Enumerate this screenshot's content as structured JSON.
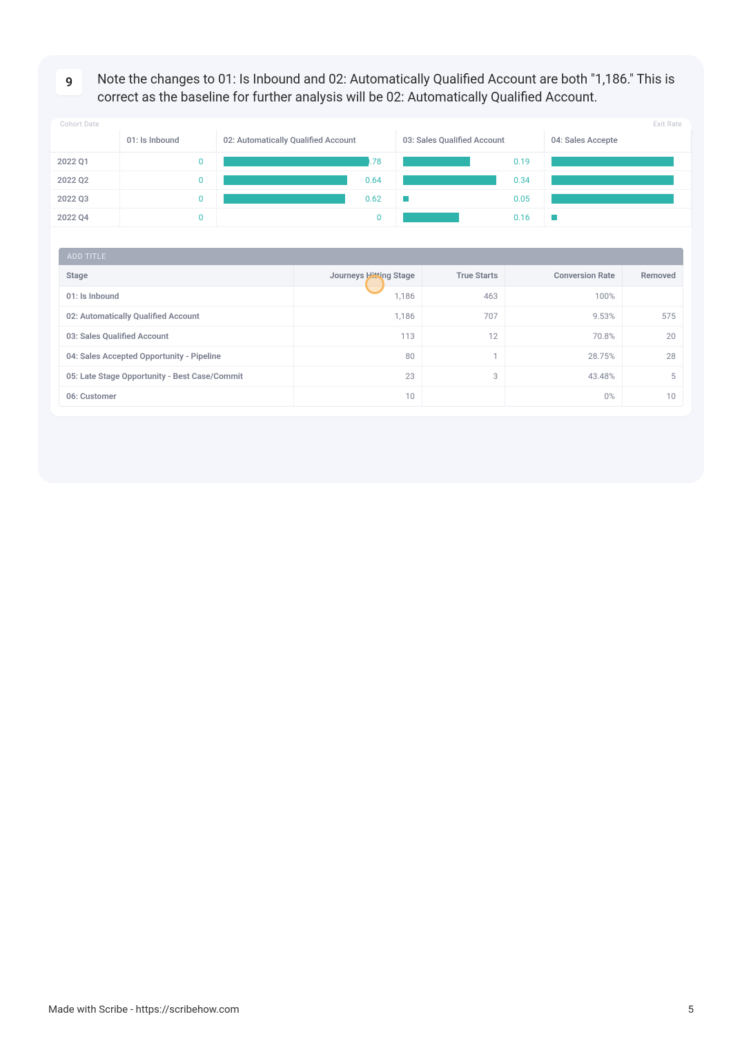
{
  "step": {
    "number": "9",
    "text": "Note the changes to 01: Is Inbound and 02: Automatically Qualified Account are both \"1,186.\" This is correct as the baseline for further analysis will be 02: Automatically Qualified Account."
  },
  "cohort": {
    "top_left": "Cohort Date",
    "top_right": "Exit Rate",
    "headers": {
      "c1": "01: Is Inbound",
      "c2": "02: Automatically Qualified Account",
      "c3": "03: Sales Qualified Account",
      "c4": "04: Sales Accepte"
    },
    "rows": [
      {
        "period": "2022 Q1",
        "inb": "0",
        "v02": "0.78",
        "w02": 88,
        "v03": "0.19",
        "w03": 50,
        "tiny03": false,
        "v04": "",
        "w04": 92,
        "tiny04": false
      },
      {
        "period": "2022 Q2",
        "inb": "0",
        "v02": "0.64",
        "w02": 75,
        "v03": "0.34",
        "w03": 70,
        "tiny03": false,
        "v04": "",
        "w04": 92,
        "tiny04": false
      },
      {
        "period": "2022 Q3",
        "inb": "0",
        "v02": "0.62",
        "w02": 74,
        "v03": "0.05",
        "w03": 0,
        "tiny03": true,
        "v04": "",
        "w04": 92,
        "tiny04": false
      },
      {
        "period": "2022 Q4",
        "inb": "0",
        "v02": "0",
        "w02": 0,
        "v03": "0.16",
        "w03": 42,
        "tiny03": false,
        "v04": "",
        "w04": 0,
        "tiny04": true
      }
    ]
  },
  "title_placeholder": "ADD TITLE",
  "stage": {
    "headers": {
      "s": "Stage",
      "j": "Journeys Hitting Stage",
      "t": "True Starts",
      "c": "Conversion Rate",
      "r": "Removed"
    },
    "rows": [
      {
        "s": "01: Is Inbound",
        "j": "1,186",
        "t": "463",
        "c": "100%",
        "r": ""
      },
      {
        "s": "02: Automatically Qualified Account",
        "j": "1,186",
        "t": "707",
        "c": "9.53%",
        "r": "575"
      },
      {
        "s": "03: Sales Qualified Account",
        "j": "113",
        "t": "12",
        "c": "70.8%",
        "r": "20"
      },
      {
        "s": "04: Sales Accepted Opportunity - Pipeline",
        "j": "80",
        "t": "1",
        "c": "28.75%",
        "r": "28"
      },
      {
        "s": "05: Late Stage Opportunity - Best Case/Commit",
        "j": "23",
        "t": "3",
        "c": "43.48%",
        "r": "5"
      },
      {
        "s": "06: Customer",
        "j": "10",
        "t": "",
        "c": "0%",
        "r": "10"
      }
    ]
  },
  "footer": {
    "left": "Made with Scribe - https://scribehow.com",
    "right": "5"
  }
}
